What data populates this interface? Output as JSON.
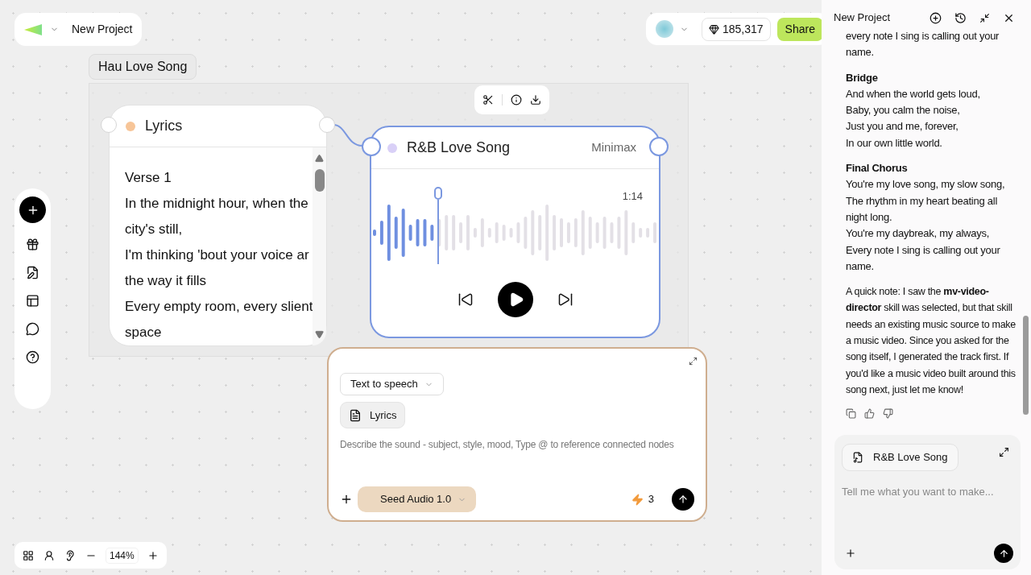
{
  "header": {
    "project_name": "New Project"
  },
  "account": {
    "credits": "185,317",
    "share": "Share"
  },
  "group": {
    "label": "Hau Love Song"
  },
  "nodes": [
    {
      "kind": "text",
      "title": "Lyrics",
      "color": "#f7c598",
      "selected": false,
      "lines": [
        "Verse 1",
        "In the midnight hour, when the",
        "city's still,",
        "I'm thinking 'bout your voice ar",
        "the way it fills",
        "Every empty room, every slient",
        "space"
      ]
    },
    {
      "kind": "audio",
      "title": "R&B Love Song",
      "provider": "Minimax",
      "color": "#d9d0f7",
      "selected": true,
      "time": "1:14"
    }
  ],
  "prompt": {
    "mode": "Text to speech",
    "reference": "Lyrics",
    "placeholder": "Describe the sound - subject, style, mood, Type @ to reference connected nodes",
    "model": "Seed Audio 1.0",
    "cost": "3"
  },
  "zoom": {
    "value": "144%"
  },
  "chat": {
    "title": "New Project",
    "blocks": [
      {
        "lines": [
          "every note I sing is calling out your name."
        ]
      },
      {
        "heading": "Bridge",
        "lines": [
          "And when the world gets loud,",
          "Baby, you calm the noise,",
          "Just you and me, forever,",
          "In our own little world."
        ]
      },
      {
        "heading": "Final Chorus",
        "lines": [
          "You're my love song, my slow song,",
          "The rhythm in my heart beating all night long.",
          "You're my daybreak, my always,",
          "Every note I sing is calling out your name."
        ]
      }
    ],
    "note": "A quick note: I saw the **mv-video-director** skill was selected, but that skill needs an existing music source to make a music video. Since you asked for the song itself, I generated the track first. If you'd like a music video built around this song next, just let me know!",
    "attachment": "R&B Love Song",
    "placeholder": "Tell me what you want to make..."
  }
}
